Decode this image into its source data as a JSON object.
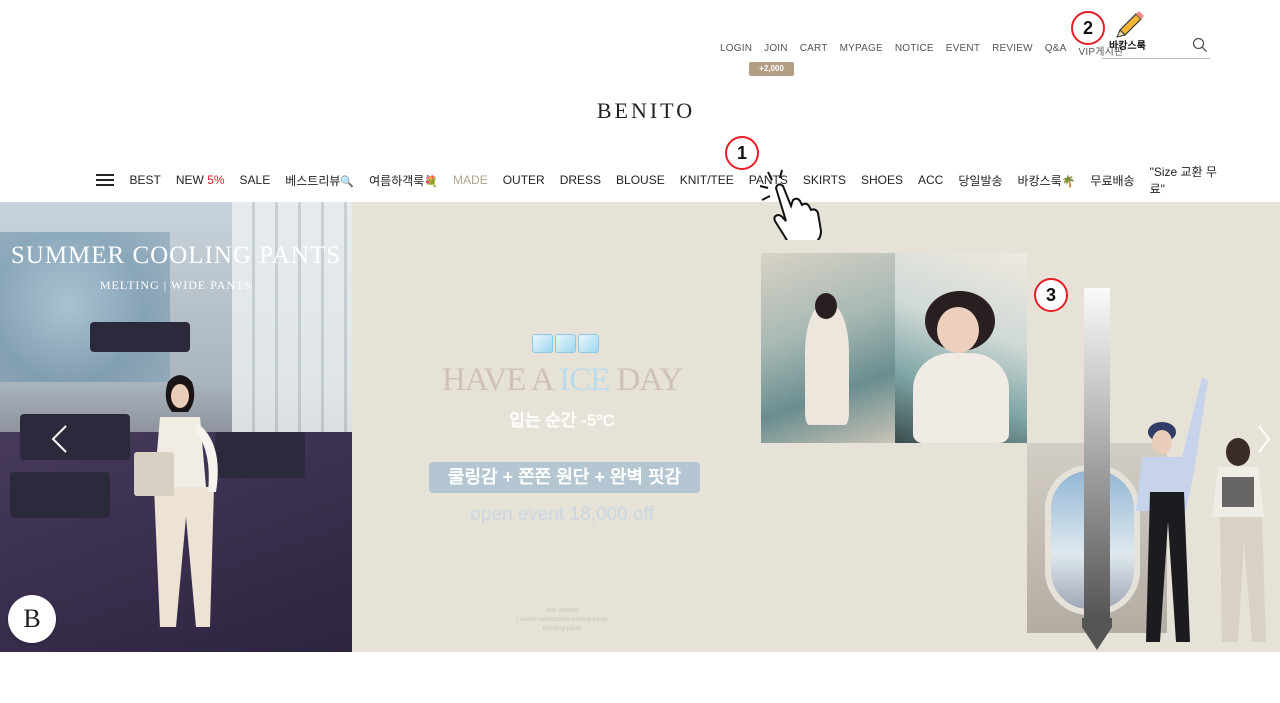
{
  "util_links": [
    "LOGIN",
    "JOIN",
    "CART",
    "MYPAGE",
    "NOTICE",
    "EVENT",
    "REVIEW",
    "Q&A",
    "VIP게시판"
  ],
  "join_badge": "+2,000",
  "search": {
    "value": "바캉스룩"
  },
  "logo": "BENITO",
  "nav": {
    "items": [
      {
        "label": "BEST"
      },
      {
        "label": "NEW",
        "extra": "5%"
      },
      {
        "label": "SALE"
      },
      {
        "label": "베스트리뷰",
        "emoji": "🔍"
      },
      {
        "label": "여름하객룩",
        "emoji": "💐"
      },
      {
        "label": "MADE",
        "muted": true
      },
      {
        "label": "OUTER"
      },
      {
        "label": "DRESS"
      },
      {
        "label": "BLOUSE"
      },
      {
        "label": "KNIT/TEE"
      },
      {
        "label": "PANTS"
      },
      {
        "label": "SKIRTS"
      },
      {
        "label": "SHOES"
      },
      {
        "label": "ACC"
      },
      {
        "label": "당일발송"
      },
      {
        "label": "바캉스룩",
        "emoji": "🌴"
      },
      {
        "label": "무료배송"
      }
    ],
    "right": "\"Size 교환 무료\""
  },
  "banner_left": {
    "title": "SUMMER COOLING PANTS",
    "subtitle": "MELTING  |  WIDE PANTS",
    "badge": "B"
  },
  "banner_mid": {
    "headline_a": "HAVE A ",
    "headline_ice": "ICE",
    "headline_b": " DAY",
    "sub": "입는 순간 -5ºC",
    "pill": "쿨링감 + 쫀쫀 원단 + 완벽 핏감",
    "event": "open event  18,000 off",
    "tiny": [
      "with melting",
      "I added comfortable training pants",
      "#cooling pants"
    ]
  },
  "markers": [
    "1",
    "2",
    "3"
  ],
  "colors": {
    "accent": "#b39d84",
    "sale": "#d6242c",
    "marker": "#e51d24"
  }
}
